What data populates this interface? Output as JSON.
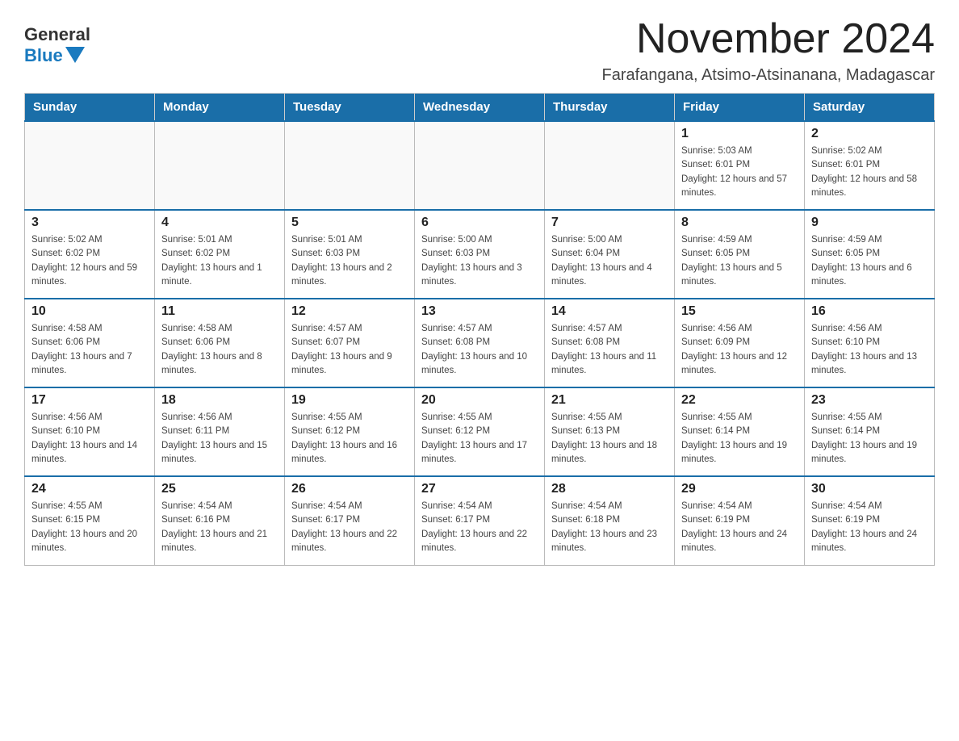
{
  "header": {
    "logo_general": "General",
    "logo_blue": "Blue",
    "month_title": "November 2024",
    "location": "Farafangana, Atsimo-Atsinanana, Madagascar"
  },
  "weekdays": [
    "Sunday",
    "Monday",
    "Tuesday",
    "Wednesday",
    "Thursday",
    "Friday",
    "Saturday"
  ],
  "weeks": [
    [
      {
        "day": "",
        "sunrise": "",
        "sunset": "",
        "daylight": ""
      },
      {
        "day": "",
        "sunrise": "",
        "sunset": "",
        "daylight": ""
      },
      {
        "day": "",
        "sunrise": "",
        "sunset": "",
        "daylight": ""
      },
      {
        "day": "",
        "sunrise": "",
        "sunset": "",
        "daylight": ""
      },
      {
        "day": "",
        "sunrise": "",
        "sunset": "",
        "daylight": ""
      },
      {
        "day": "1",
        "sunrise": "Sunrise: 5:03 AM",
        "sunset": "Sunset: 6:01 PM",
        "daylight": "Daylight: 12 hours and 57 minutes."
      },
      {
        "day": "2",
        "sunrise": "Sunrise: 5:02 AM",
        "sunset": "Sunset: 6:01 PM",
        "daylight": "Daylight: 12 hours and 58 minutes."
      }
    ],
    [
      {
        "day": "3",
        "sunrise": "Sunrise: 5:02 AM",
        "sunset": "Sunset: 6:02 PM",
        "daylight": "Daylight: 12 hours and 59 minutes."
      },
      {
        "day": "4",
        "sunrise": "Sunrise: 5:01 AM",
        "sunset": "Sunset: 6:02 PM",
        "daylight": "Daylight: 13 hours and 1 minute."
      },
      {
        "day": "5",
        "sunrise": "Sunrise: 5:01 AM",
        "sunset": "Sunset: 6:03 PM",
        "daylight": "Daylight: 13 hours and 2 minutes."
      },
      {
        "day": "6",
        "sunrise": "Sunrise: 5:00 AM",
        "sunset": "Sunset: 6:03 PM",
        "daylight": "Daylight: 13 hours and 3 minutes."
      },
      {
        "day": "7",
        "sunrise": "Sunrise: 5:00 AM",
        "sunset": "Sunset: 6:04 PM",
        "daylight": "Daylight: 13 hours and 4 minutes."
      },
      {
        "day": "8",
        "sunrise": "Sunrise: 4:59 AM",
        "sunset": "Sunset: 6:05 PM",
        "daylight": "Daylight: 13 hours and 5 minutes."
      },
      {
        "day": "9",
        "sunrise": "Sunrise: 4:59 AM",
        "sunset": "Sunset: 6:05 PM",
        "daylight": "Daylight: 13 hours and 6 minutes."
      }
    ],
    [
      {
        "day": "10",
        "sunrise": "Sunrise: 4:58 AM",
        "sunset": "Sunset: 6:06 PM",
        "daylight": "Daylight: 13 hours and 7 minutes."
      },
      {
        "day": "11",
        "sunrise": "Sunrise: 4:58 AM",
        "sunset": "Sunset: 6:06 PM",
        "daylight": "Daylight: 13 hours and 8 minutes."
      },
      {
        "day": "12",
        "sunrise": "Sunrise: 4:57 AM",
        "sunset": "Sunset: 6:07 PM",
        "daylight": "Daylight: 13 hours and 9 minutes."
      },
      {
        "day": "13",
        "sunrise": "Sunrise: 4:57 AM",
        "sunset": "Sunset: 6:08 PM",
        "daylight": "Daylight: 13 hours and 10 minutes."
      },
      {
        "day": "14",
        "sunrise": "Sunrise: 4:57 AM",
        "sunset": "Sunset: 6:08 PM",
        "daylight": "Daylight: 13 hours and 11 minutes."
      },
      {
        "day": "15",
        "sunrise": "Sunrise: 4:56 AM",
        "sunset": "Sunset: 6:09 PM",
        "daylight": "Daylight: 13 hours and 12 minutes."
      },
      {
        "day": "16",
        "sunrise": "Sunrise: 4:56 AM",
        "sunset": "Sunset: 6:10 PM",
        "daylight": "Daylight: 13 hours and 13 minutes."
      }
    ],
    [
      {
        "day": "17",
        "sunrise": "Sunrise: 4:56 AM",
        "sunset": "Sunset: 6:10 PM",
        "daylight": "Daylight: 13 hours and 14 minutes."
      },
      {
        "day": "18",
        "sunrise": "Sunrise: 4:56 AM",
        "sunset": "Sunset: 6:11 PM",
        "daylight": "Daylight: 13 hours and 15 minutes."
      },
      {
        "day": "19",
        "sunrise": "Sunrise: 4:55 AM",
        "sunset": "Sunset: 6:12 PM",
        "daylight": "Daylight: 13 hours and 16 minutes."
      },
      {
        "day": "20",
        "sunrise": "Sunrise: 4:55 AM",
        "sunset": "Sunset: 6:12 PM",
        "daylight": "Daylight: 13 hours and 17 minutes."
      },
      {
        "day": "21",
        "sunrise": "Sunrise: 4:55 AM",
        "sunset": "Sunset: 6:13 PM",
        "daylight": "Daylight: 13 hours and 18 minutes."
      },
      {
        "day": "22",
        "sunrise": "Sunrise: 4:55 AM",
        "sunset": "Sunset: 6:14 PM",
        "daylight": "Daylight: 13 hours and 19 minutes."
      },
      {
        "day": "23",
        "sunrise": "Sunrise: 4:55 AM",
        "sunset": "Sunset: 6:14 PM",
        "daylight": "Daylight: 13 hours and 19 minutes."
      }
    ],
    [
      {
        "day": "24",
        "sunrise": "Sunrise: 4:55 AM",
        "sunset": "Sunset: 6:15 PM",
        "daylight": "Daylight: 13 hours and 20 minutes."
      },
      {
        "day": "25",
        "sunrise": "Sunrise: 4:54 AM",
        "sunset": "Sunset: 6:16 PM",
        "daylight": "Daylight: 13 hours and 21 minutes."
      },
      {
        "day": "26",
        "sunrise": "Sunrise: 4:54 AM",
        "sunset": "Sunset: 6:17 PM",
        "daylight": "Daylight: 13 hours and 22 minutes."
      },
      {
        "day": "27",
        "sunrise": "Sunrise: 4:54 AM",
        "sunset": "Sunset: 6:17 PM",
        "daylight": "Daylight: 13 hours and 22 minutes."
      },
      {
        "day": "28",
        "sunrise": "Sunrise: 4:54 AM",
        "sunset": "Sunset: 6:18 PM",
        "daylight": "Daylight: 13 hours and 23 minutes."
      },
      {
        "day": "29",
        "sunrise": "Sunrise: 4:54 AM",
        "sunset": "Sunset: 6:19 PM",
        "daylight": "Daylight: 13 hours and 24 minutes."
      },
      {
        "day": "30",
        "sunrise": "Sunrise: 4:54 AM",
        "sunset": "Sunset: 6:19 PM",
        "daylight": "Daylight: 13 hours and 24 minutes."
      }
    ]
  ]
}
